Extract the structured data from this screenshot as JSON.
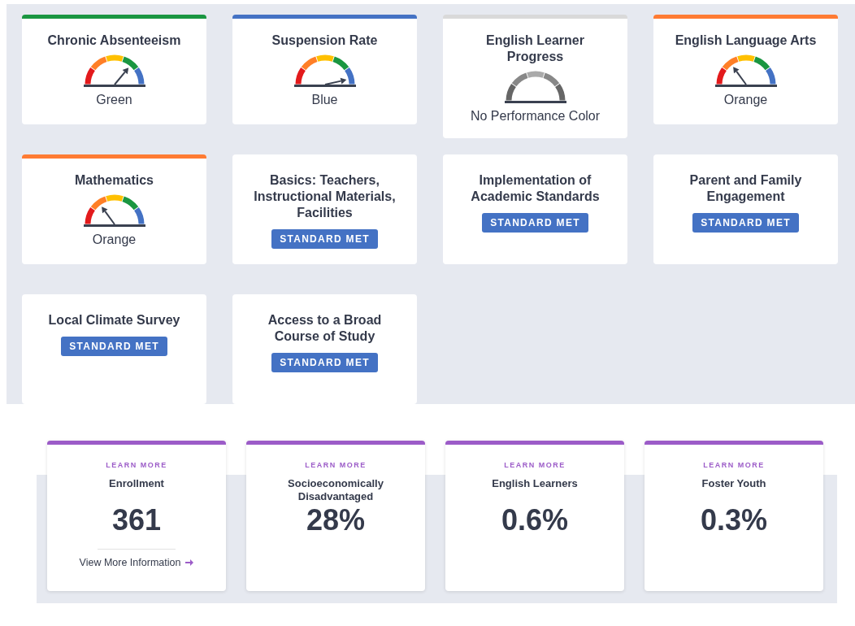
{
  "indicators": [
    {
      "kind": "green",
      "title": "Chronic Absenteeism",
      "color": "#1a9641",
      "status": "Green"
    },
    {
      "kind": "blue",
      "title": "Suspension Rate",
      "color": "#4472c4",
      "status": "Blue"
    },
    {
      "kind": "none",
      "title": "English Learner Progress",
      "color": "#d9d9d9",
      "status": "No Performance Color"
    },
    {
      "kind": "orange",
      "title": "English Language Arts",
      "color": "#ff7b33",
      "status": "Orange"
    },
    {
      "kind": "orange",
      "title": "Mathematics",
      "color": "#ff7b33",
      "status": "Orange"
    },
    {
      "kind": "standard",
      "title": "Basics: Teachers, Instructional Materials, Facilities",
      "badge": "STANDARD MET"
    },
    {
      "kind": "standard",
      "title": "Implementation of Academic Standards",
      "badge": "STANDARD MET"
    },
    {
      "kind": "standard",
      "title": "Parent and Family Engagement",
      "badge": "STANDARD MET"
    },
    {
      "kind": "standard",
      "title": "Local Climate Survey",
      "badge": "STANDARD MET"
    },
    {
      "kind": "standard",
      "title": "Access to a Broad Course of Study",
      "badge": "STANDARD MET"
    }
  ],
  "stats": [
    {
      "eyebrow": "LEARN MORE",
      "title": "Enrollment",
      "value": "361",
      "link": "View More Information"
    },
    {
      "eyebrow": "LEARN MORE",
      "title": "Socioeconomically Disadvantaged",
      "value": "28%"
    },
    {
      "eyebrow": "LEARN MORE",
      "title": "English Learners",
      "value": "0.6%"
    },
    {
      "eyebrow": "LEARN MORE",
      "title": "Foster Youth",
      "value": "0.3%"
    }
  ]
}
